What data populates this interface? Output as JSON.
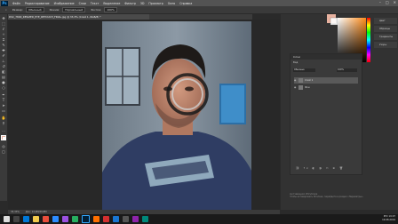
{
  "app": {
    "name": "Ps"
  },
  "menu": [
    "Файл",
    "Редактирование",
    "Изображение",
    "Слои",
    "Текст",
    "Выделение",
    "Фильтр",
    "3D",
    "Просмотр",
    "Окно",
    "Справка"
  ],
  "window_controls": [
    "–",
    "□",
    "✕"
  ],
  "options": {
    "size_label": "Размер:",
    "size_value": "Обычный",
    "mode_label": "Режим:",
    "mode_value": "Нормальный",
    "exposure_label": "Экспоз:",
    "exposure_value": "100%"
  },
  "document_tab": "DSC_7890_RESIZED_EYE_RETOUCH_FINAL.jpg @ 33,3% (Слой 1, RGB/8) *",
  "tools": [
    "move",
    "marquee",
    "lasso",
    "wand",
    "crop",
    "eyedropper",
    "heal",
    "brush",
    "stamp",
    "history",
    "eraser",
    "gradient",
    "blur",
    "dodge",
    "pen",
    "type",
    "path",
    "shape",
    "hand",
    "zoom"
  ],
  "right_icons": [
    "Цвет",
    "Образцы",
    "Градиенты",
    "Узоры"
  ],
  "layers": {
    "title": "Слои",
    "filter_label": "Вид",
    "blend": "Обычные",
    "opacity": "100%",
    "items": [
      {
        "name": "Слой 1",
        "selected": true
      },
      {
        "name": "Фон",
        "selected": false
      }
    ]
  },
  "watermark": {
    "line1": "Активация Windows",
    "line2": "Чтобы активировать Windows, перейдите в раздел «Параметры»."
  },
  "status": {
    "zoom": "33,33%",
    "doc": "Док: 14,9M/29,8M"
  },
  "taskbar": {
    "time": "19:07",
    "date": "19.08.2019",
    "lang": "РУС"
  },
  "colors": {
    "accent": "#31a8ff",
    "fg_color": "#e8b2a0"
  }
}
